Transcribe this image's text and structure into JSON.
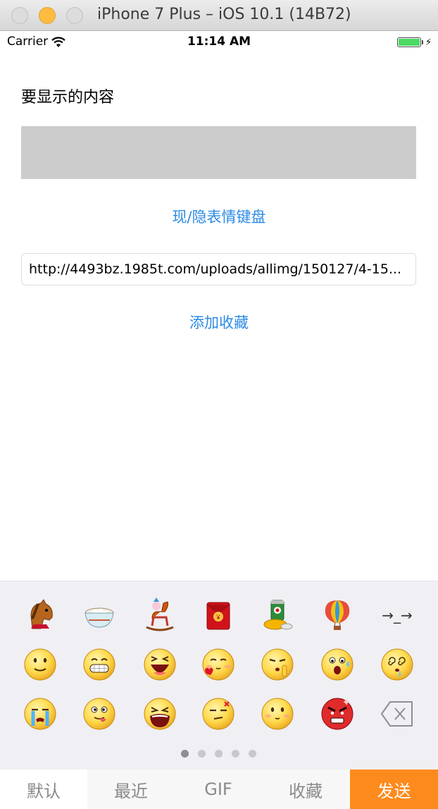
{
  "window": {
    "title": "iPhone 7 Plus – iOS 10.1 (14B72)"
  },
  "status_bar": {
    "carrier": "Carrier",
    "time": "11:14 AM",
    "battery_color": "#4cd964"
  },
  "main": {
    "content_label": "要显示的内容",
    "toggle_keyboard_label": "现/隐表情键盘",
    "url_value": "http://4493bz.1985t.com/uploads/allimg/150127/4-15...",
    "add_favorite_label": "添加收藏",
    "accent_color": "#2b8ae4"
  },
  "keyboard": {
    "emoji_rows": [
      [
        "horse-head-icon",
        "rice-ball-bowl-icon",
        "rocking-horse-icon",
        "red-envelope-icon",
        "beer-can-icon",
        "hot-air-balloon-icon",
        "arrow-symbol"
      ],
      [
        "smile-face-icon",
        "grin-face-icon",
        "laugh-face-icon",
        "heart-blush-face-icon",
        "shush-face-icon",
        "shock-face-icon",
        "dizzy-face-icon"
      ],
      [
        "crying-face-icon",
        "tongue-face-icon",
        "scream-face-icon",
        "annoyed-face-icon",
        "blush-face-icon",
        "angry-face-icon",
        "delete-key-icon"
      ]
    ],
    "arrow_symbol_text": "→_→",
    "page_count": 5,
    "active_page": 1
  },
  "tab_bar": {
    "tabs": [
      {
        "label": "默认",
        "selected": true
      },
      {
        "label": "最近",
        "selected": false
      },
      {
        "label": "GIF",
        "selected": false
      },
      {
        "label": "收藏",
        "selected": false
      }
    ],
    "send_label": "发送",
    "send_color": "#fd8a1c"
  }
}
